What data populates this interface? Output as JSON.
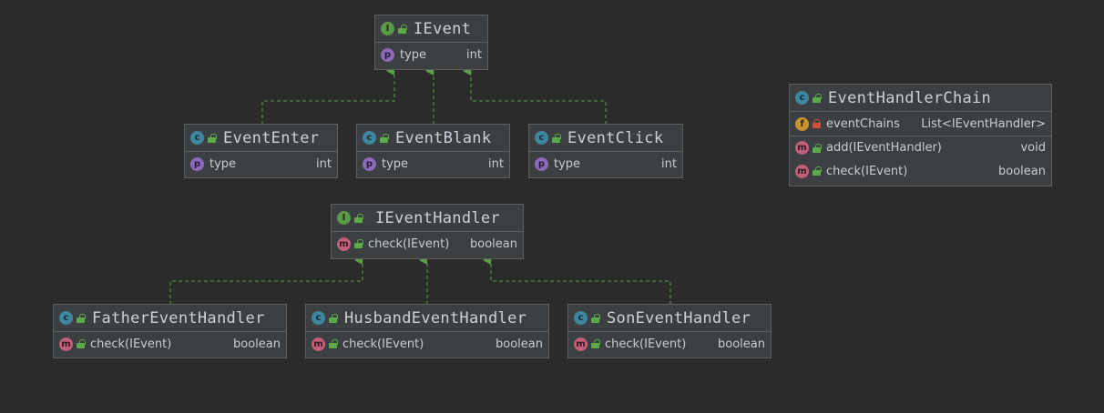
{
  "diagram": {
    "ievent": {
      "title": "IEvent",
      "badge": "I",
      "field": {
        "badge": "p",
        "name": "type",
        "type": "int"
      }
    },
    "event_enter": {
      "title": "EventEnter",
      "badge": "c",
      "field": {
        "badge": "p",
        "name": "type",
        "type": "int"
      }
    },
    "event_blank": {
      "title": "EventBlank",
      "badge": "c",
      "field": {
        "badge": "p",
        "name": "type",
        "type": "int"
      }
    },
    "event_click": {
      "title": "EventClick",
      "badge": "c",
      "field": {
        "badge": "p",
        "name": "type",
        "type": "int"
      }
    },
    "ievent_handler": {
      "title": "IEventHandler",
      "badge": "I",
      "method": {
        "badge": "m",
        "name": "check(IEvent)",
        "type": "boolean"
      }
    },
    "father_handler": {
      "title": "FatherEventHandler",
      "badge": "c",
      "method": {
        "badge": "m",
        "name": "check(IEvent)",
        "type": "boolean"
      }
    },
    "husband_handler": {
      "title": "HusbandEventHandler",
      "badge": "c",
      "method": {
        "badge": "m",
        "name": "check(IEvent)",
        "type": "boolean"
      }
    },
    "son_handler": {
      "title": "SonEventHandler",
      "badge": "c",
      "method": {
        "badge": "m",
        "name": "check(IEvent)",
        "type": "boolean"
      }
    },
    "chain": {
      "title": "EventHandlerChain",
      "badge": "c",
      "field": {
        "badge": "f",
        "name": "eventChains",
        "type": "List<IEventHandler>"
      },
      "methods": [
        {
          "badge": "m",
          "name": "add(IEventHandler)",
          "type": "void"
        },
        {
          "badge": "m",
          "name": "check(IEvent)",
          "type": "boolean"
        }
      ]
    }
  },
  "colors": {
    "background": "#2b2b2b",
    "node": "#3c3f41",
    "edge": "#5b9e46",
    "class_badge": "#3e86a0",
    "interface_badge": "#5a9a45",
    "property_badge": "#8d6ab8",
    "method_badge": "#c25e78",
    "field_badge": "#c8942e"
  },
  "icons": {
    "class": "class-badge-icon",
    "interface": "interface-badge-icon",
    "property": "property-badge-icon",
    "method": "method-badge-icon",
    "field": "field-badge-icon",
    "public": "open-lock-icon",
    "private": "lock-icon"
  }
}
